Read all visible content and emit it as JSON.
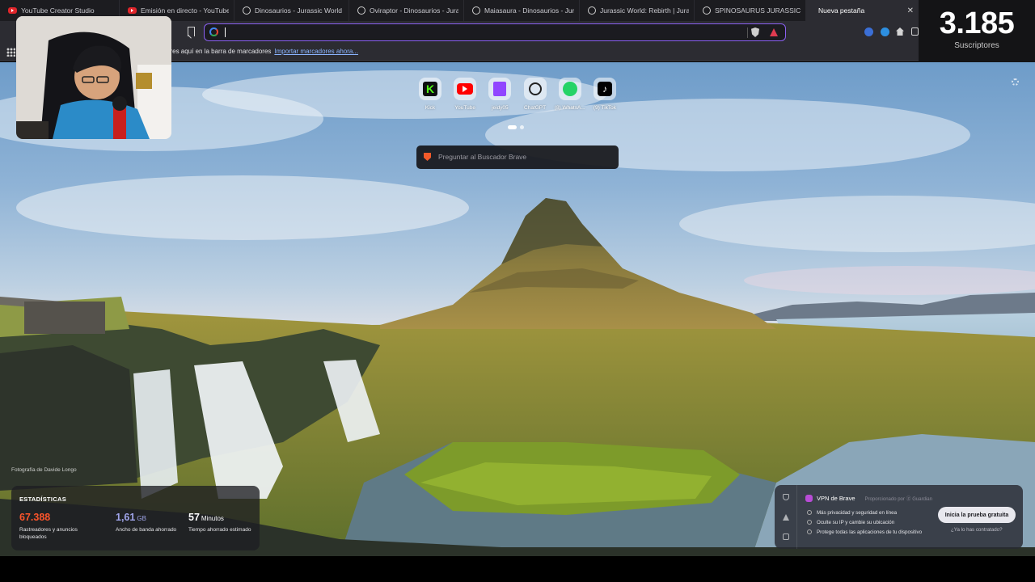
{
  "tabs": [
    {
      "label": "YouTube Creator Studio",
      "icon": "youtube-icon"
    },
    {
      "label": "Emisión en directo - YouTube S",
      "icon": "youtube-icon"
    },
    {
      "label": "Dinosaurios - Jurassic World Ev",
      "icon": "dino-icon"
    },
    {
      "label": "Oviraptor - Dinosaurios - Juras",
      "icon": "dino-icon"
    },
    {
      "label": "Maiasaura - Dinosaurios - Jura",
      "icon": "dino-icon"
    },
    {
      "label": "Jurassic World: Rebirth | Jurass",
      "icon": "dino-icon"
    },
    {
      "label": "SPINOSAURUS JURASSIC WOR",
      "icon": "globe-icon"
    },
    {
      "label": "Nueva pestaña",
      "icon": "",
      "active": true
    }
  ],
  "toolbar": {
    "address_value": ""
  },
  "bookmarks_bar": {
    "text": "ores aquí en la barra de marcadores",
    "import_link": "Importar marcadores ahora..."
  },
  "subscriber_counter": {
    "count": "3.185",
    "label": "Suscriptores"
  },
  "top_sites": [
    {
      "name": "Kick",
      "icon": "kick-icon"
    },
    {
      "name": "YouTube",
      "icon": "youtube-icon"
    },
    {
      "name": "jeidy05",
      "icon": "twitch-icon"
    },
    {
      "name": "ChatGPT",
      "icon": "chatgpt-icon"
    },
    {
      "name": "(8) WhatsA...",
      "icon": "whatsapp-icon"
    },
    {
      "name": "(9) TikTok",
      "icon": "tiktok-icon"
    }
  ],
  "search": {
    "placeholder": "Preguntar al Buscador Brave"
  },
  "photo_credit": "Fotografía de Davide Longo",
  "stats": {
    "title": "ESTADÍSTICAS",
    "items": [
      {
        "value": "67.388",
        "unit": "",
        "desc": "Rastreadores y anuncios bloqueados",
        "color": "#fb542b"
      },
      {
        "value": "1,61",
        "unit": "GB",
        "desc": "Ancho de banda ahorrado",
        "color": "#a0a5eb"
      },
      {
        "value": "57",
        "unit": "Minutos",
        "desc": "Tiempo ahorrado estimado",
        "color": "#ffffff"
      }
    ]
  },
  "vpn": {
    "title": "VPN de Brave",
    "provider": "Proporcionado por ⓖ Guardian",
    "features": [
      "Más privacidad y seguridad en línea",
      "Oculte su IP y cambie su ubicación",
      "Protege todas las aplicaciones de tu dispositivo"
    ],
    "cta": "Inicia la prueba gratuita",
    "already": "¿Ya lo has contratado?"
  },
  "colors": {
    "accent": "#8b60f2",
    "brave_orange": "#fb542b"
  }
}
